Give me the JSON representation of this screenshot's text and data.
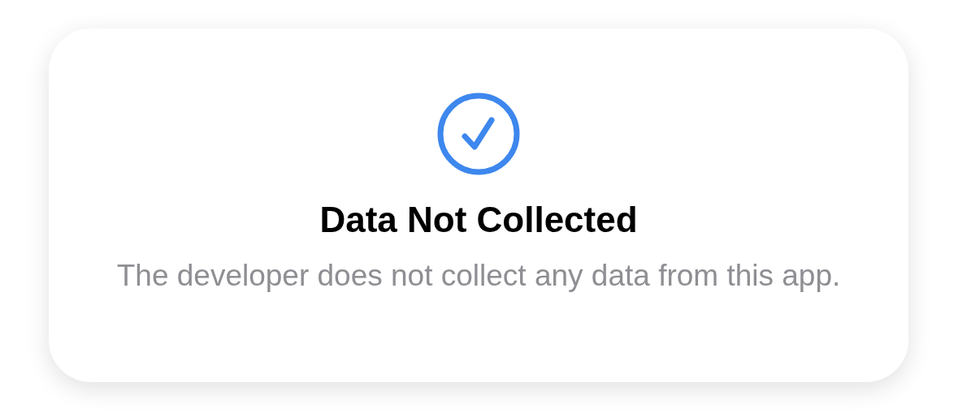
{
  "title": "Data Not Collected",
  "description": "The developer does not collect any data from this app."
}
